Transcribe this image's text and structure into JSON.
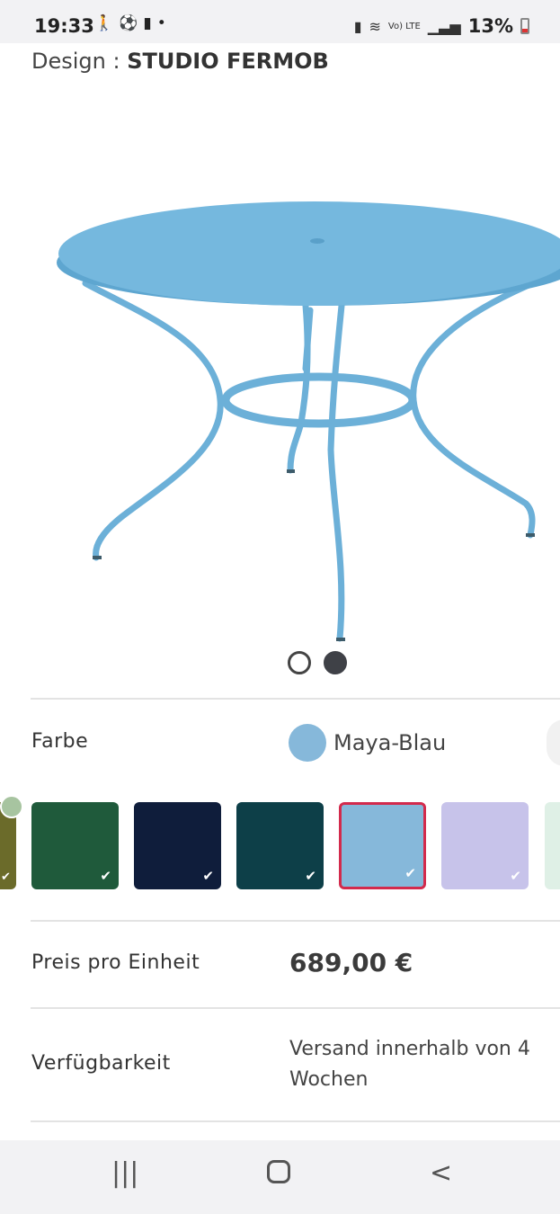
{
  "status_bar": {
    "time": "19:33",
    "left_icons": [
      "walking-icon",
      "soccer-icon",
      "alert-icon",
      "dot-icon"
    ],
    "network_label": "Vo) LTE",
    "battery": "13%"
  },
  "designer": {
    "prefix": "Design : ",
    "name": "STUDIO FERMOB"
  },
  "product_image": {
    "subject": "blue round metal garden table",
    "color": "#6cb0d8"
  },
  "carousel": {
    "pages": 2,
    "active_index": 1
  },
  "color_row": {
    "label": "Farbe",
    "selected_name": "Maya-Blau",
    "selected_color": "#86b8da"
  },
  "swatches": [
    {
      "color": "#1f5a3b",
      "selected": false
    },
    {
      "color": "#0f1d3b",
      "selected": false
    },
    {
      "color": "#0d3f48",
      "selected": false
    },
    {
      "color": "#86b8da",
      "selected": true
    },
    {
      "color": "#c7c3ea",
      "selected": false
    }
  ],
  "price_row": {
    "label": "Preis pro Einheit",
    "value": "689,00 €"
  },
  "availability_row": {
    "label": "Verfügbarkeit",
    "value": "Versand innerhalb von 4 Wochen"
  },
  "nav_bar": {
    "recents": "|||",
    "home": "○",
    "back": "<"
  }
}
